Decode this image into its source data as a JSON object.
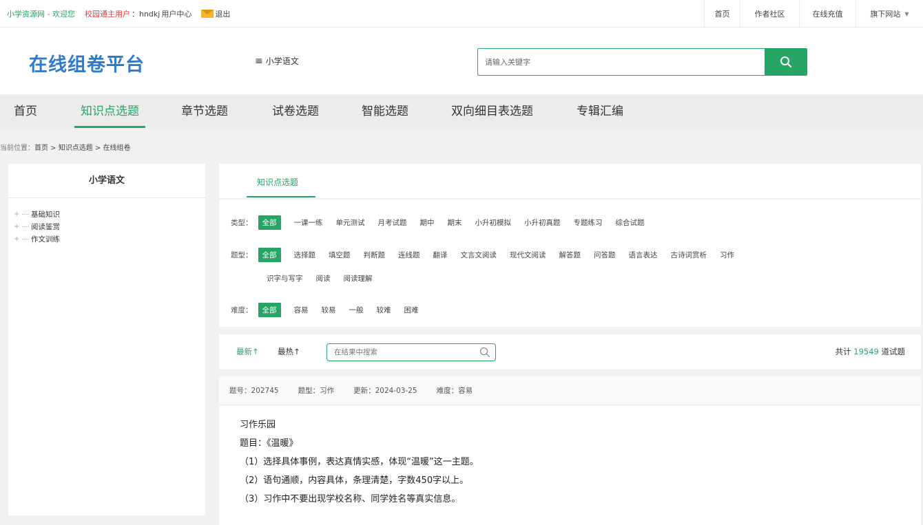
{
  "topbar": {
    "site_name": "小学资源网 - 欢迎您",
    "user_type": "校园通主用户",
    "username": "：hndkj",
    "user_center": "用户中心",
    "logout": "退出",
    "links": [
      "首页",
      "作者社区",
      "在线充值",
      "旗下网站"
    ]
  },
  "header": {
    "logo": "在线组卷平台",
    "subject": "小学语文",
    "search_placeholder": "请输入关键字"
  },
  "nav": {
    "items": [
      "首页",
      "知识点选题",
      "章节选题",
      "试卷选题",
      "智能选题",
      "双向细目表选题",
      "专辑汇编"
    ],
    "active": "知识点选题"
  },
  "breadcrumb": {
    "prefix": "当前位置：",
    "path": "首页 > 知识点选题 > 在线组卷"
  },
  "sidebar": {
    "title": "小学语文",
    "items": [
      "基础知识",
      "阅读鉴赏",
      "作文训练"
    ]
  },
  "tabs": {
    "active": "知识点选题"
  },
  "filters": {
    "type": {
      "label": "类型：",
      "options": [
        "全部",
        "一课一练",
        "单元测试",
        "月考试题",
        "期中",
        "期末",
        "小升初模拟",
        "小升初真题",
        "专题练习",
        "综合试题"
      ]
    },
    "question_type": {
      "label": "题型：",
      "options": [
        "全部",
        "选择题",
        "填空题",
        "判断题",
        "连线题",
        "翻译",
        "文言文阅读",
        "现代文阅读",
        "解答题",
        "问答题",
        "语言表达",
        "古诗词赏析",
        "习作"
      ],
      "options_row2": [
        "识字与写字",
        "阅读",
        "阅读理解"
      ]
    },
    "difficulty": {
      "label": "难度：",
      "options": [
        "全部",
        "容易",
        "较易",
        "一般",
        "较难",
        "困难"
      ]
    }
  },
  "sortbar": {
    "newest": "最新↑",
    "hottest": "最热↑",
    "search_placeholder": "在结果中搜索",
    "total_prefix": "共计",
    "total_count": "19549",
    "total_suffix": "道试题"
  },
  "question": {
    "id": "题号：202745",
    "type": "题型：习作",
    "updated": "更新：2024-03-25",
    "difficulty": "难度：容易",
    "lines": [
      "习作乐园",
      "题目：《温暖》",
      "（1）选择具体事例，表达真情实感，体现“温暖”这一主题。",
      "（2）语句通顺，内容具体，条理清楚，字数450字以上。",
      "（3）习作中不要出现学校名称、同学姓名等真实信息。"
    ]
  },
  "colors": {
    "accent": "#27a567",
    "logo": "#2f7ac9",
    "user_type": "#e6393d"
  }
}
